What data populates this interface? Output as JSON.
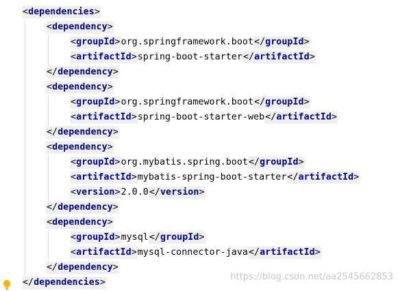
{
  "lines": [
    {
      "tag": "dependencies",
      "kind": "open"
    },
    {
      "tag": "dependency",
      "kind": "open"
    },
    {
      "tag": "groupId",
      "kind": "pair",
      "value": "org.springframework.boot"
    },
    {
      "tag": "artifactId",
      "kind": "pair",
      "value": "spring-boot-starter"
    },
    {
      "tag": "dependency",
      "kind": "close"
    },
    {
      "tag": "dependency",
      "kind": "open"
    },
    {
      "tag": "groupId",
      "kind": "pair",
      "value": "org.springframework.boot"
    },
    {
      "tag": "artifactId",
      "kind": "pair",
      "value": "spring-boot-starter-web"
    },
    {
      "tag": "dependency",
      "kind": "close"
    },
    {
      "tag": "dependency",
      "kind": "open"
    },
    {
      "tag": "groupId",
      "kind": "pair",
      "value": "org.mybatis.spring.boot"
    },
    {
      "tag": "artifactId",
      "kind": "pair",
      "value": "mybatis-spring-boot-starter"
    },
    {
      "tag": "version",
      "kind": "pair",
      "value": "2.0.0"
    },
    {
      "tag": "dependency",
      "kind": "close"
    },
    {
      "tag": "dependency",
      "kind": "open"
    },
    {
      "tag": "groupId",
      "kind": "pair",
      "value": "mysql"
    },
    {
      "tag": "artifactId",
      "kind": "pair",
      "value": "mysql-connector-java"
    },
    {
      "tag": "dependency",
      "kind": "close"
    },
    {
      "tag": "dependencies",
      "kind": "close"
    }
  ],
  "watermark": "https://blog.csdn.net/aa2545662853",
  "gutter_icon": "lightbulb-icon",
  "colors": {
    "tag_name": "#000080",
    "tag_bg": "#efefef",
    "text": "#000000",
    "bulb": "#f5b800"
  }
}
